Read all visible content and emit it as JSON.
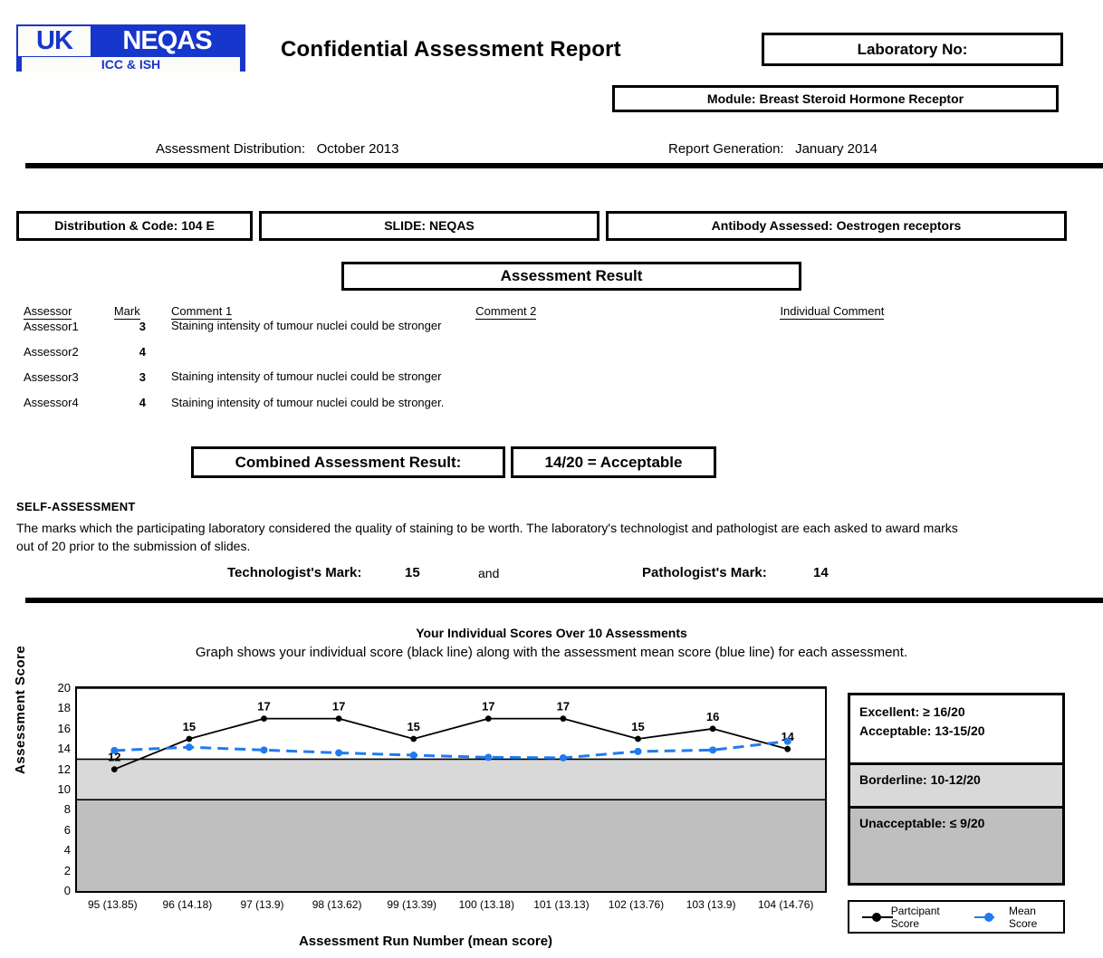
{
  "header": {
    "logo": {
      "uk": "UK",
      "neqas": "NEQAS",
      "sub": "ICC & ISH"
    },
    "report_title": "Confidential  Assessment Report",
    "lab_no": "Laboratory No:",
    "module": "Module: Breast Steroid Hormone Receptor",
    "assessment_distribution_label": "Assessment Distribution:",
    "assessment_distribution_value": "October 2013",
    "report_generation_label": "Report Generation:",
    "report_generation_value": "January 2014"
  },
  "distribution": {
    "code": "Distribution & Code: 104 E",
    "slide": "SLIDE: NEQAS",
    "antibody": "Antibody Assessed: Oestrogen receptors",
    "assessment_result_heading": "Assessment Result"
  },
  "assessor_table": {
    "headers": {
      "assessor": "Assessor",
      "mark": "Mark",
      "comment1": "Comment 1",
      "comment2": "Comment 2",
      "individual": "Individual Comment"
    },
    "rows": [
      {
        "assessor": "Assessor1",
        "mark": "3",
        "comment1": "Staining intensity of tumour nuclei could be stronger",
        "comment2": "",
        "individual": ""
      },
      {
        "assessor": "Assessor2",
        "mark": "4",
        "comment1": "",
        "comment2": "",
        "individual": ""
      },
      {
        "assessor": "Assessor3",
        "mark": "3",
        "comment1": "Staining intensity of tumour nuclei could be stronger",
        "comment2": "",
        "individual": ""
      },
      {
        "assessor": "Assessor4",
        "mark": "4",
        "comment1": "Staining intensity of tumour nuclei could be stronger.",
        "comment2": "",
        "individual": ""
      }
    ]
  },
  "combined": {
    "label": "Combined Assessment Result:",
    "value": "14/20 = Acceptable"
  },
  "self_assessment": {
    "title": "SELF-ASSESSMENT",
    "description": "The marks which the participating laboratory considered the quality of staining to be worth. The laboratory's technologist and pathologist are each asked to award marks out of 20 prior to the submission of slides.",
    "technologist_label": "Technologist's Mark:",
    "technologist_value": "15",
    "and": "and",
    "pathologist_label": "Pathologist's Mark:",
    "pathologist_value": "14"
  },
  "graph_section": {
    "title": "Your Individual Scores Over 10 Assessments",
    "subtitle": "Graph shows your individual score (black line) along with the assessment mean score (blue line) for each assessment."
  },
  "grading_legend": {
    "excellent": "Excellent: ≥ 16/20",
    "acceptable": "Acceptable: 13-15/20",
    "borderline": "Borderline: 10-12/20",
    "unacceptable": "Unacceptable: ≤ 9/20"
  },
  "colors": {
    "participant": "#000000",
    "mean": "#1f7bf0",
    "logo_blue": "#1736cc",
    "band_borderline": "#d9d9d9",
    "band_unacceptable": "#bfbfbf"
  },
  "chart_data": {
    "type": "line",
    "title": "Your Individual Scores Over 10 Assessments",
    "xlabel": "Assessment Run Number (mean score)",
    "ylabel": "Assessment Score",
    "ylim": [
      0,
      20
    ],
    "ytick_step": 2,
    "yticks": [
      20,
      18,
      16,
      14,
      12,
      10,
      8,
      6,
      4,
      2,
      0
    ],
    "grid": false,
    "legend_position": "below-right",
    "categories": [
      "95 (13.85)",
      "96 (14.18)",
      "97 (13.9)",
      "98 (13.62)",
      "99 (13.39)",
      "100 (13.18)",
      "101 (13.13)",
      "102 (13.76)",
      "103 (13.9)",
      "104 (14.76)"
    ],
    "run_numbers": [
      95,
      96,
      97,
      98,
      99,
      100,
      101,
      102,
      103,
      104
    ],
    "series": [
      {
        "name": "Partcipant Score",
        "color": "#000000",
        "style": "solid",
        "marker": "circle",
        "labels_shown": true,
        "values": [
          12,
          15,
          17,
          17,
          15,
          17,
          17,
          15,
          16,
          14
        ]
      },
      {
        "name": "Mean Score",
        "color": "#1f7bf0",
        "style": "dashed",
        "marker": "circle",
        "labels_shown": false,
        "values": [
          13.85,
          14.18,
          13.9,
          13.62,
          13.39,
          13.18,
          13.13,
          13.76,
          13.9,
          14.76
        ]
      }
    ],
    "bands": [
      {
        "label": "Excellent / Acceptable",
        "from": 13,
        "to": 20,
        "color": "#ffffff"
      },
      {
        "label": "Borderline",
        "from": 9,
        "to": 13,
        "color": "#d9d9d9"
      },
      {
        "label": "Unacceptable",
        "from": 0,
        "to": 9,
        "color": "#bfbfbf"
      }
    ]
  }
}
